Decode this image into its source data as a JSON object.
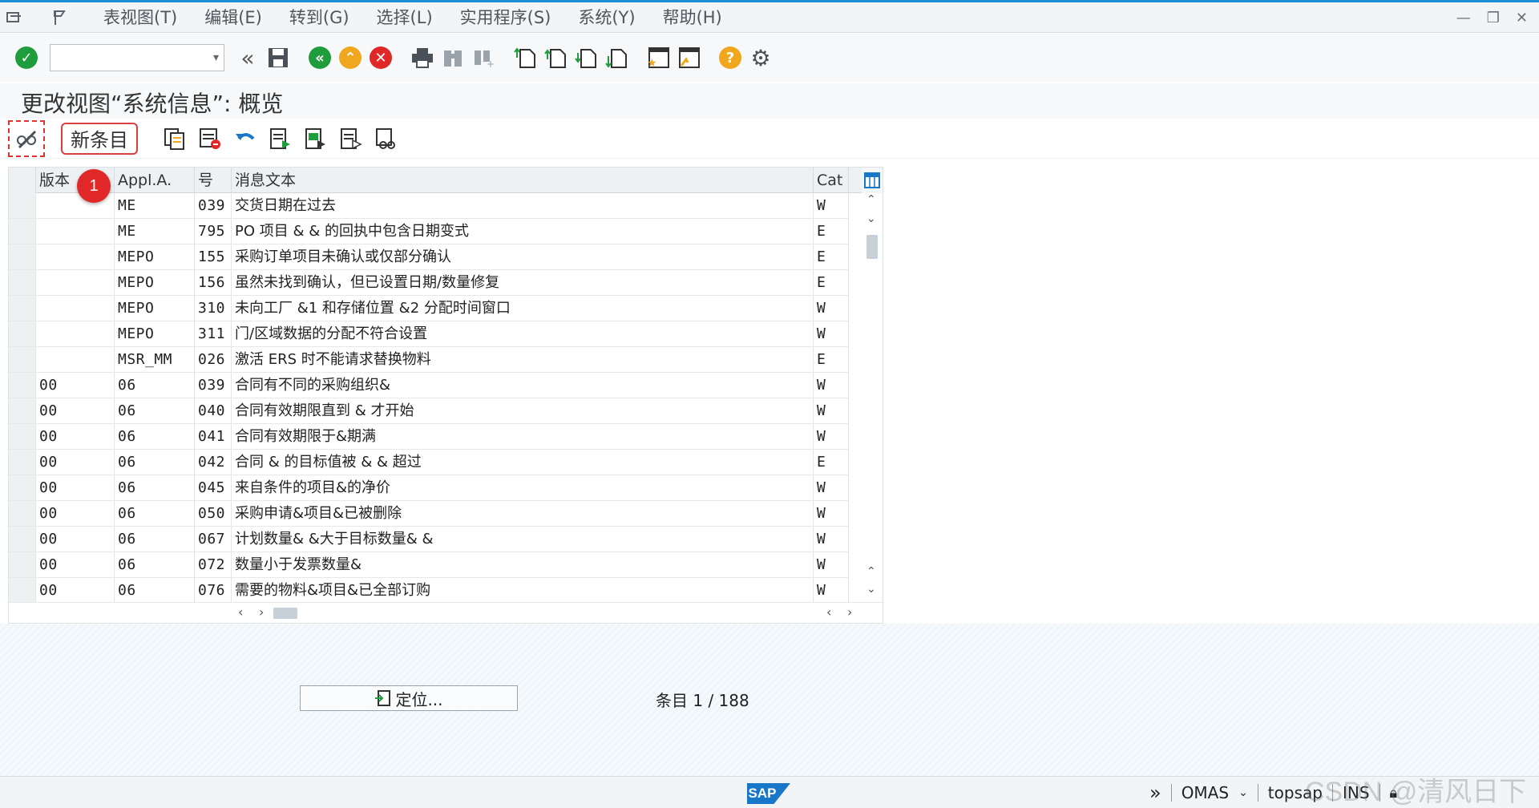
{
  "menu": {
    "items": [
      "表视图(T)",
      "编辑(E)",
      "转到(G)",
      "选择(L)",
      "实用程序(S)",
      "系统(Y)",
      "帮助(H)"
    ]
  },
  "page_title": "更改视图“系统信息”: 概览",
  "app_toolbar": {
    "new_entry_label": "新条目"
  },
  "annotation_badge": "1",
  "table": {
    "headers": [
      "版本",
      "Appl.A.",
      "号",
      "消息文本",
      "Cat"
    ],
    "rows": [
      [
        "",
        "ME",
        "039",
        "交货日期在过去",
        "W"
      ],
      [
        "",
        "ME",
        "795",
        "PO 项目 & & 的回执中包含日期变式",
        "E"
      ],
      [
        "",
        "MEPO",
        "155",
        "采购订单项目未确认或仅部分确认",
        "E"
      ],
      [
        "",
        "MEPO",
        "156",
        "虽然未找到确认，但已设置日期/数量修复",
        "E"
      ],
      [
        "",
        "MEPO",
        "310",
        "未向工厂 &1 和存储位置 &2 分配时间窗口",
        "W"
      ],
      [
        "",
        "MEPO",
        "311",
        "门/区域数据的分配不符合设置",
        "W"
      ],
      [
        "",
        "MSR_MM",
        "026",
        "激活 ERS 时不能请求替换物料",
        "E"
      ],
      [
        "00",
        "06",
        "039",
        "合同有不同的采购组织&",
        "W"
      ],
      [
        "00",
        "06",
        "040",
        "合同有效期限直到 & 才开始",
        "W"
      ],
      [
        "00",
        "06",
        "041",
        "合同有效期限于&期满",
        "W"
      ],
      [
        "00",
        "06",
        "042",
        "合同 & 的目标值被 & & 超过",
        "E"
      ],
      [
        "00",
        "06",
        "045",
        "来自条件的项目&的净价",
        "W"
      ],
      [
        "00",
        "06",
        "050",
        "采购申请&项目&已被删除",
        "W"
      ],
      [
        "00",
        "06",
        "067",
        "计划数量& &大于目标数量& &",
        "W"
      ],
      [
        "00",
        "06",
        "072",
        "数量小于发票数量&",
        "W"
      ],
      [
        "00",
        "06",
        "076",
        "需要的物料&项目&已全部订购",
        "W"
      ]
    ]
  },
  "position_button": {
    "label": "定位..."
  },
  "entry_counter": {
    "prefix": "条目 ",
    "value": "1 / 188"
  },
  "status": {
    "sap_logo": "SAP",
    "system": "OMAS",
    "user": "topsap",
    "mode": "INS"
  },
  "watermark": "CSDN @清风日下",
  "colors": {
    "accent": "#1a8fd8",
    "badge": "#e02828",
    "new_entry_border": "#d84040"
  }
}
